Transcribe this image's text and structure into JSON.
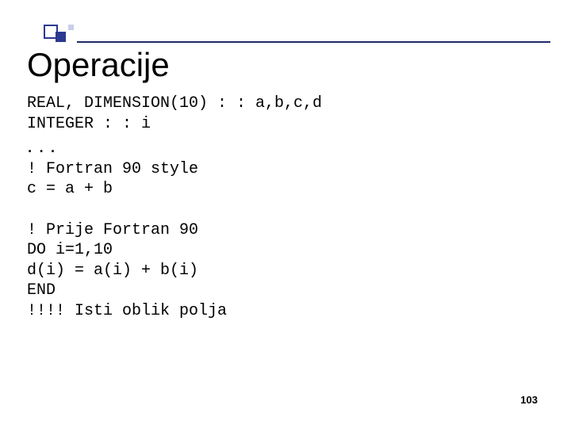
{
  "title": "Operacije",
  "code": {
    "l1": "REAL, DIMENSION(10) : : a,b,c,d",
    "l2": "INTEGER : : i",
    "dots": ". . .",
    "l3": "! Fortran 90 style",
    "l4": "c = a + b",
    "blank1": " ",
    "l5": "! Prije Fortran 90",
    "l6": "DO i=1,10",
    "l7": "d(i) = a(i) + b(i)",
    "l8": "END",
    "l9": "!!!! Isti oblik polja"
  },
  "page_number": "103"
}
